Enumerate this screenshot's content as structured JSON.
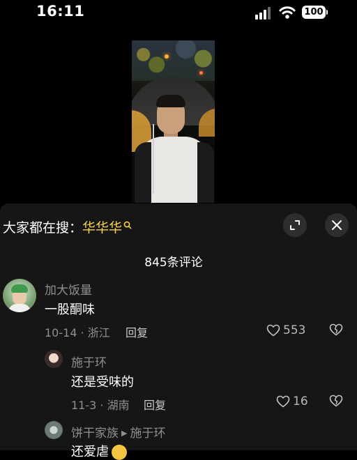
{
  "status_bar": {
    "time": "16:11",
    "battery": "100"
  },
  "search_hint": {
    "prefix": "大家都在搜：",
    "term": "华华华"
  },
  "comment_count": "845条评论",
  "comments": [
    {
      "username": "加大饭量",
      "text": "一股酮味",
      "meta": "10-14 · 浙江",
      "reply_label": "回复",
      "likes": "553"
    }
  ],
  "replies": [
    {
      "username": "施于环",
      "text": "还是受味的",
      "meta": "11-3 · 湖南",
      "reply_label": "回复",
      "likes": "16"
    },
    {
      "username": "饼干家族",
      "reply_to": "施于环",
      "text": "还爱虐"
    }
  ],
  "colors": {
    "background": "#000000",
    "panel": "#161616",
    "search_term": "#f6d54a",
    "secondary_text": "#8f8f8f"
  },
  "icons": [
    "signal-icon",
    "wifi-icon",
    "battery-icon",
    "search-icon",
    "expand-icon",
    "close-icon",
    "heart-icon",
    "broken-heart-icon",
    "emoji-icon"
  ]
}
